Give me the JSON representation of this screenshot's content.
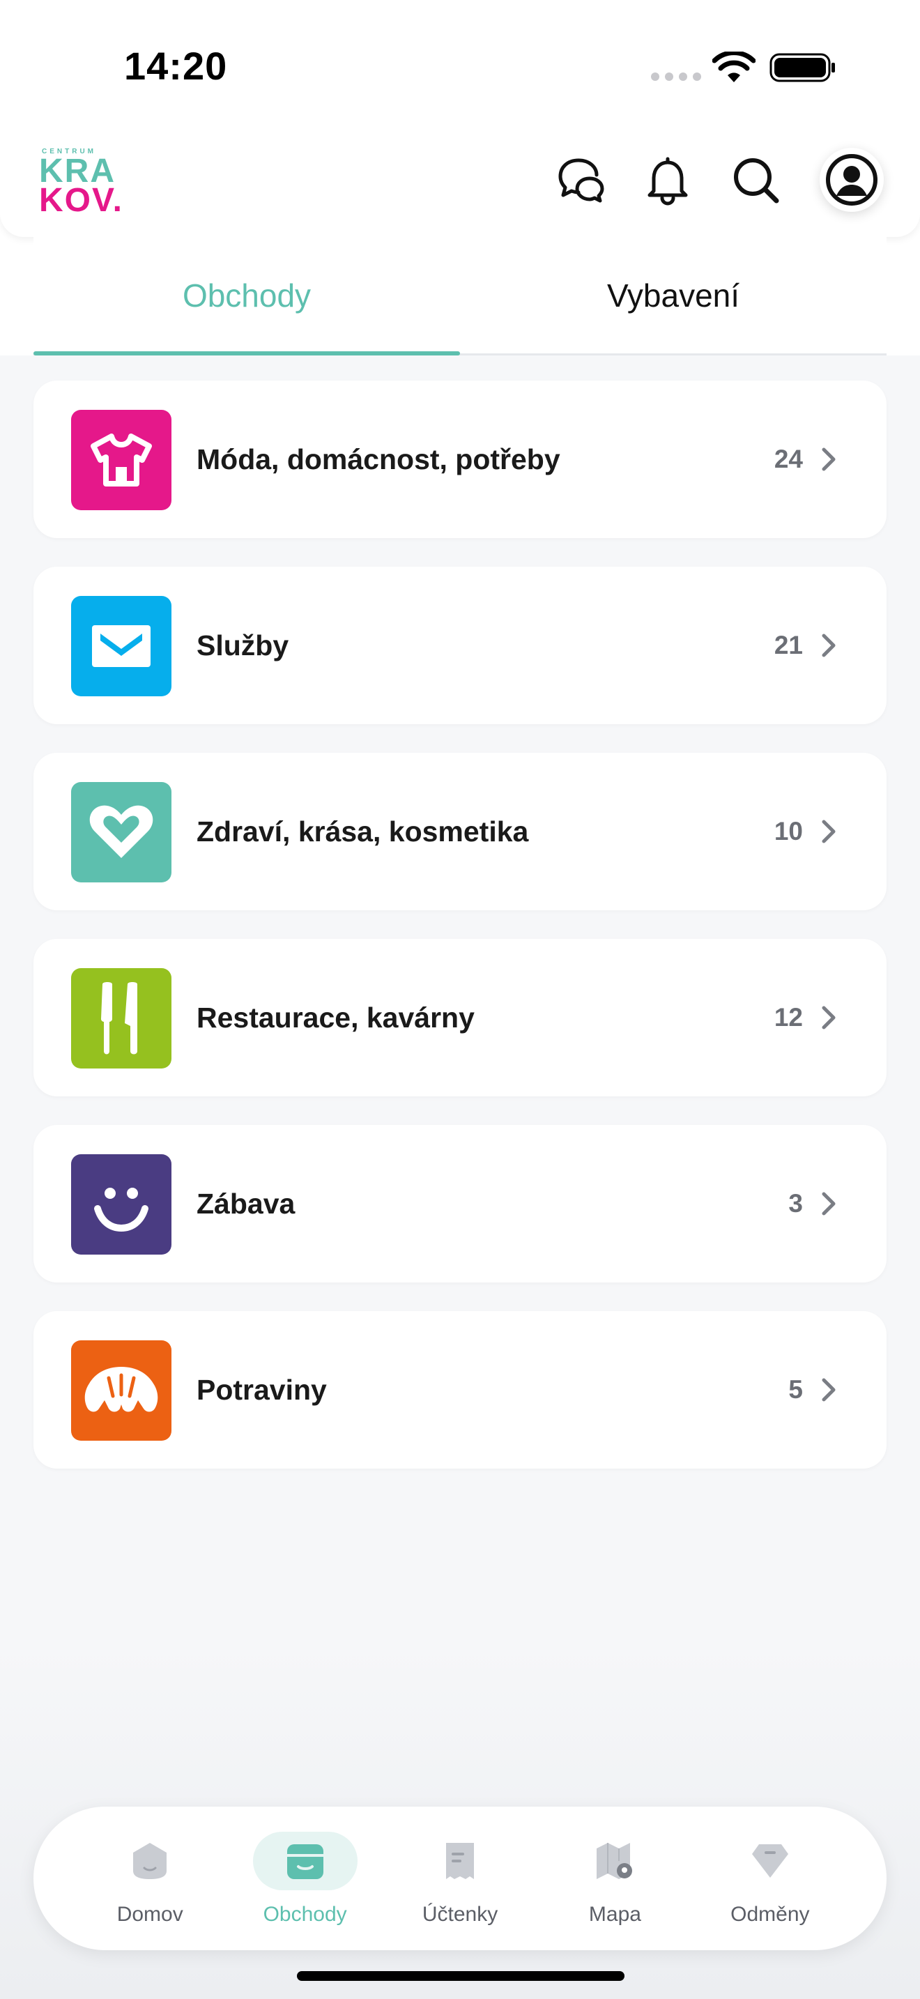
{
  "status_bar": {
    "time": "14:20"
  },
  "header": {
    "logo": {
      "small": "CENTRUM",
      "line1": "KRA",
      "line2": "KOV."
    },
    "icons": [
      "chat-icon",
      "bell-icon",
      "search-icon",
      "user-avatar-icon"
    ]
  },
  "tabs": [
    {
      "label": "Obchody",
      "active": true
    },
    {
      "label": "Vybavení",
      "active": false
    }
  ],
  "categories": [
    {
      "label": "Móda, domácnost, potřeby",
      "count": "24",
      "color": "#e5188a",
      "icon": "tshirt-icon"
    },
    {
      "label": "Služby",
      "count": "21",
      "color": "#06aeec",
      "icon": "envelope-icon"
    },
    {
      "label": "Zdraví, krása, kosmetika",
      "count": "10",
      "color": "#5dbfae",
      "icon": "heart-icon"
    },
    {
      "label": "Restaurace, kavárny",
      "count": "12",
      "color": "#95c11f",
      "icon": "cutlery-icon"
    },
    {
      "label": "Zábava",
      "count": "3",
      "color": "#4a3c82",
      "icon": "smiley-icon"
    },
    {
      "label": "Potraviny",
      "count": "5",
      "color": "#ec6113",
      "icon": "croissant-icon"
    }
  ],
  "bottom_nav": [
    {
      "label": "Domov",
      "icon": "home-icon",
      "active": false
    },
    {
      "label": "Obchody",
      "icon": "store-icon",
      "active": true
    },
    {
      "label": "Účtenky",
      "icon": "receipt-icon",
      "active": false
    },
    {
      "label": "Mapa",
      "icon": "map-icon",
      "active": false
    },
    {
      "label": "Odměny",
      "icon": "rewards-icon",
      "active": false
    }
  ],
  "colors": {
    "accent": "#5dbfae",
    "brand_pink": "#e5188a"
  }
}
